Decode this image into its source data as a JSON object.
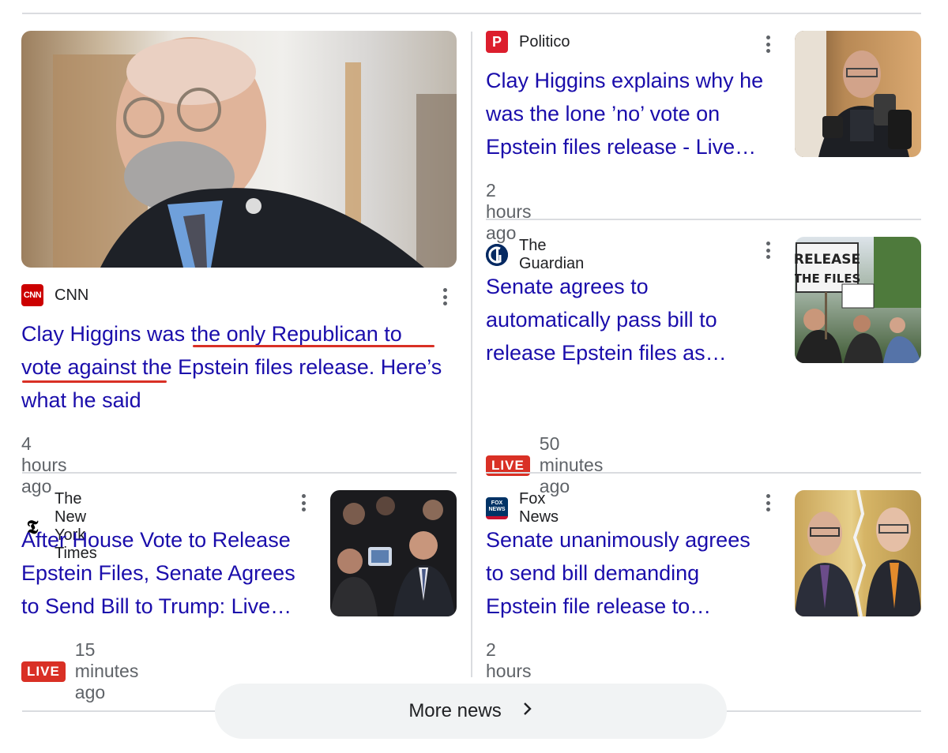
{
  "articles": [
    {
      "source": "CNN",
      "title": "Clay Higgins was the only Republican to vote against the Epstein files release. Here’s what he said",
      "title_lines": [
        "Clay Higgins was the only Republican to",
        "vote against the Epstein files release. Here’s",
        "what he said"
      ],
      "time": "4 hours ago",
      "live": false
    },
    {
      "source": "Politico",
      "title_lines": [
        "Clay Higgins explains why he",
        "was the lone ’no’ vote on",
        "Epstein files release - Live…"
      ],
      "time": "2 hours ago",
      "live": false
    },
    {
      "source": "The Guardian",
      "title_lines": [
        "Senate agrees to",
        "automatically pass bill to",
        "release Epstein files as…"
      ],
      "time": "50 minutes ago",
      "live": true
    },
    {
      "source": "The New York Times",
      "title_lines": [
        "After House Vote to Release",
        "Epstein Files, Senate Agrees",
        "to Send Bill to Trump: Live…"
      ],
      "time": "15 minutes ago",
      "live": true
    },
    {
      "source": "Fox News",
      "title_lines": [
        "Senate unanimously agrees",
        "to send bill demanding",
        "Epstein file release to…"
      ],
      "time": "2 hours ago",
      "live": false
    }
  ],
  "logos": {
    "cnn": "CNN",
    "politico": "P",
    "nyt": "𝕿",
    "fox": "FOX NEWS"
  },
  "live_label": "LIVE",
  "more_news": "More news",
  "thumb_text": {
    "guardian_sign": [
      "RELEASE",
      "THE FILES"
    ]
  },
  "colors": {
    "link": "#1a0dab",
    "live": "#d93025",
    "underline": "#d93025"
  }
}
